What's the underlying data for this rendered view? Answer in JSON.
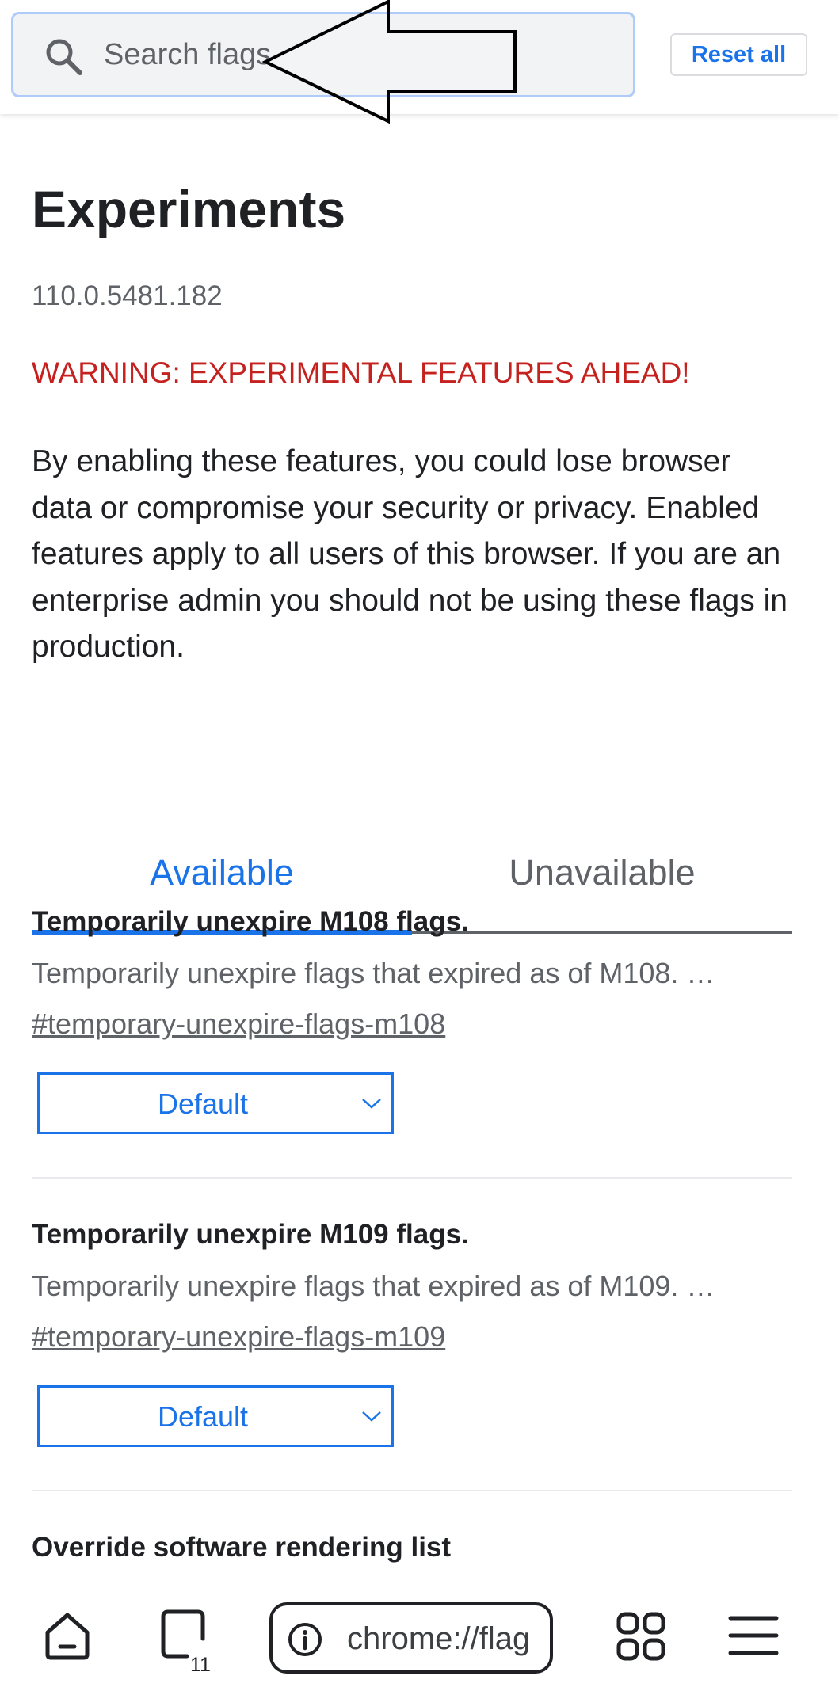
{
  "search": {
    "placeholder": "Search flags",
    "reset_label": "Reset all"
  },
  "page": {
    "title": "Experiments",
    "version": "110.0.5481.182",
    "warning": "WARNING: EXPERIMENTAL FEATURES AHEAD!",
    "intro": "By enabling these features, you could lose browser data or compromise your security or privacy. Enabled features apply to all users of this browser. If you are an enterprise admin you should not be using these flags in production."
  },
  "tabs": [
    {
      "label": "Available",
      "selected": true
    },
    {
      "label": "Unavailable",
      "selected": false
    }
  ],
  "experiments": [
    {
      "title": "Temporarily unexpire M108 flags.",
      "description": "Temporarily unexpire flags that expired as of M108. …",
      "link": "#temporary-unexpire-flags-m108",
      "value": "Default"
    },
    {
      "title": "Temporarily unexpire M109 flags.",
      "description": "Temporarily unexpire flags that expired as of M109. …",
      "link": "#temporary-unexpire-flags-m109",
      "value": "Default"
    },
    {
      "title": "Override software rendering list"
    }
  ],
  "toolbar": {
    "tab_count": "11",
    "url": "chrome://flag",
    "icons": [
      "home-icon",
      "tabs-icon",
      "info-icon",
      "apps-icon",
      "menu-icon"
    ]
  },
  "colors": {
    "accent": "#1a73e8",
    "warning": "#c5221f",
    "secondary_text": "#5f6368"
  }
}
